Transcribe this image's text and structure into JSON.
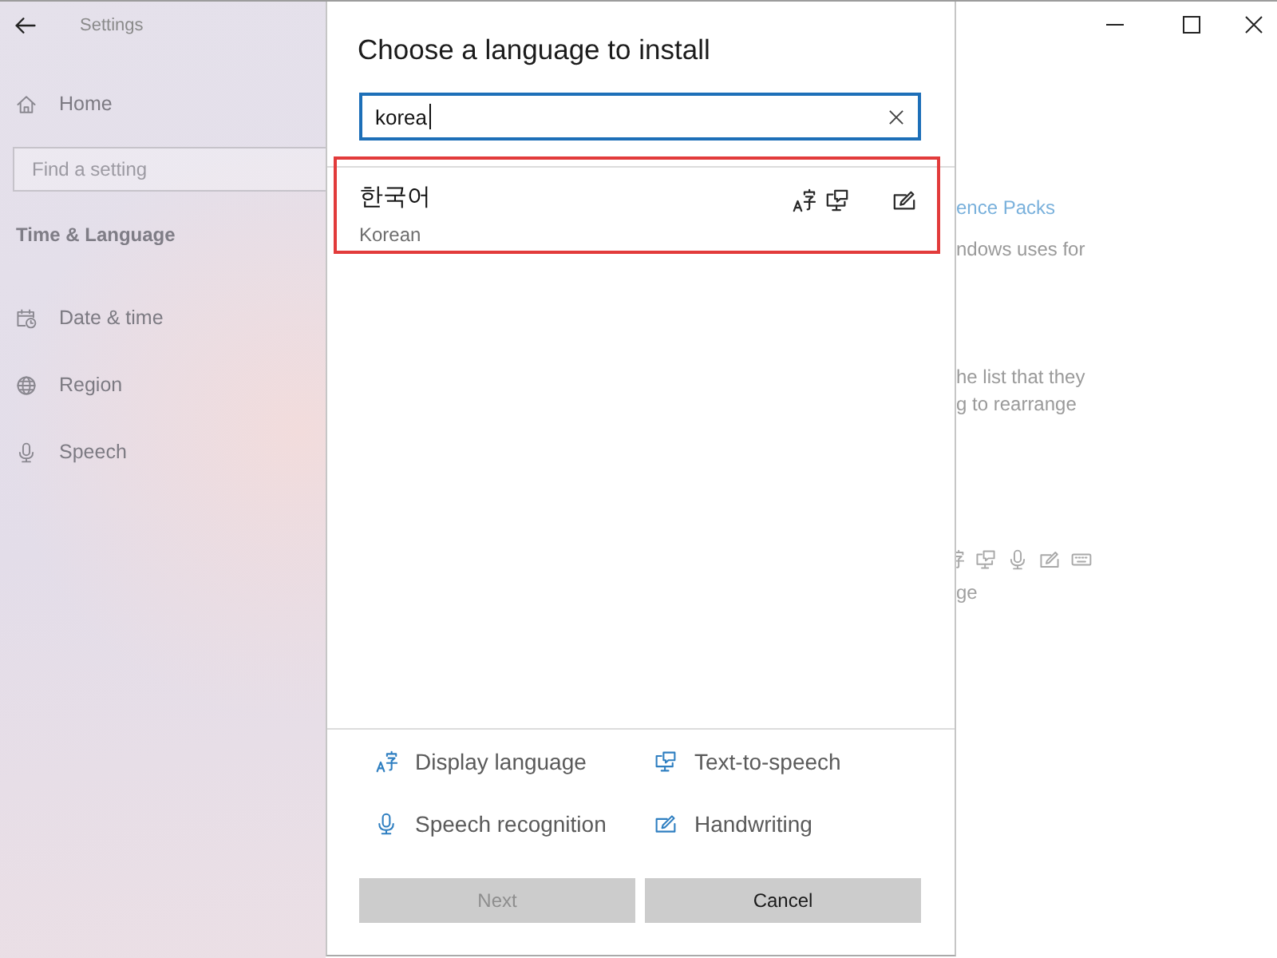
{
  "window": {
    "title": "Settings"
  },
  "sidebar": {
    "home": "Home",
    "search": {
      "placeholder": "Find a setting"
    },
    "section_title": "Time & Language",
    "items": [
      {
        "kind": "date_time",
        "label": "Date & time",
        "selected": false
      },
      {
        "kind": "region",
        "label": "Region",
        "selected": false
      },
      {
        "kind": "speech",
        "label": "Speech",
        "selected": false
      }
    ]
  },
  "dialog": {
    "title": "Choose a language to install",
    "search": {
      "value": "korea",
      "focused": true
    },
    "results": [
      {
        "native_name": "한국어",
        "name": "Korean",
        "selected": false,
        "highlighted": true,
        "features": {
          "display_language": true,
          "text_to_speech": true,
          "speech_recognition": false,
          "handwriting": true
        }
      }
    ],
    "legend": [
      {
        "kind": "display_language",
        "label": "Display language"
      },
      {
        "kind": "text_to_speech",
        "label": "Text-to-speech"
      },
      {
        "kind": "speech_recognition",
        "label": "Speech recognition"
      },
      {
        "kind": "handwriting",
        "label": "Handwriting"
      }
    ],
    "buttons": [
      {
        "label": "Next",
        "disabled": true
      },
      {
        "label": "Cancel",
        "disabled": false
      }
    ]
  },
  "background_pane": {
    "link": "ence Packs",
    "paragraphs": [
      [
        "ndows uses for"
      ],
      [
        "he list that they",
        "g to rearrange"
      ]
    ],
    "feature_icons": [
      {
        "kind": "display_language"
      },
      {
        "kind": "text_to_speech"
      },
      {
        "kind": "speech_recognition"
      },
      {
        "kind": "handwriting"
      },
      {
        "kind": "keyboard"
      }
    ],
    "caption": "ge"
  }
}
